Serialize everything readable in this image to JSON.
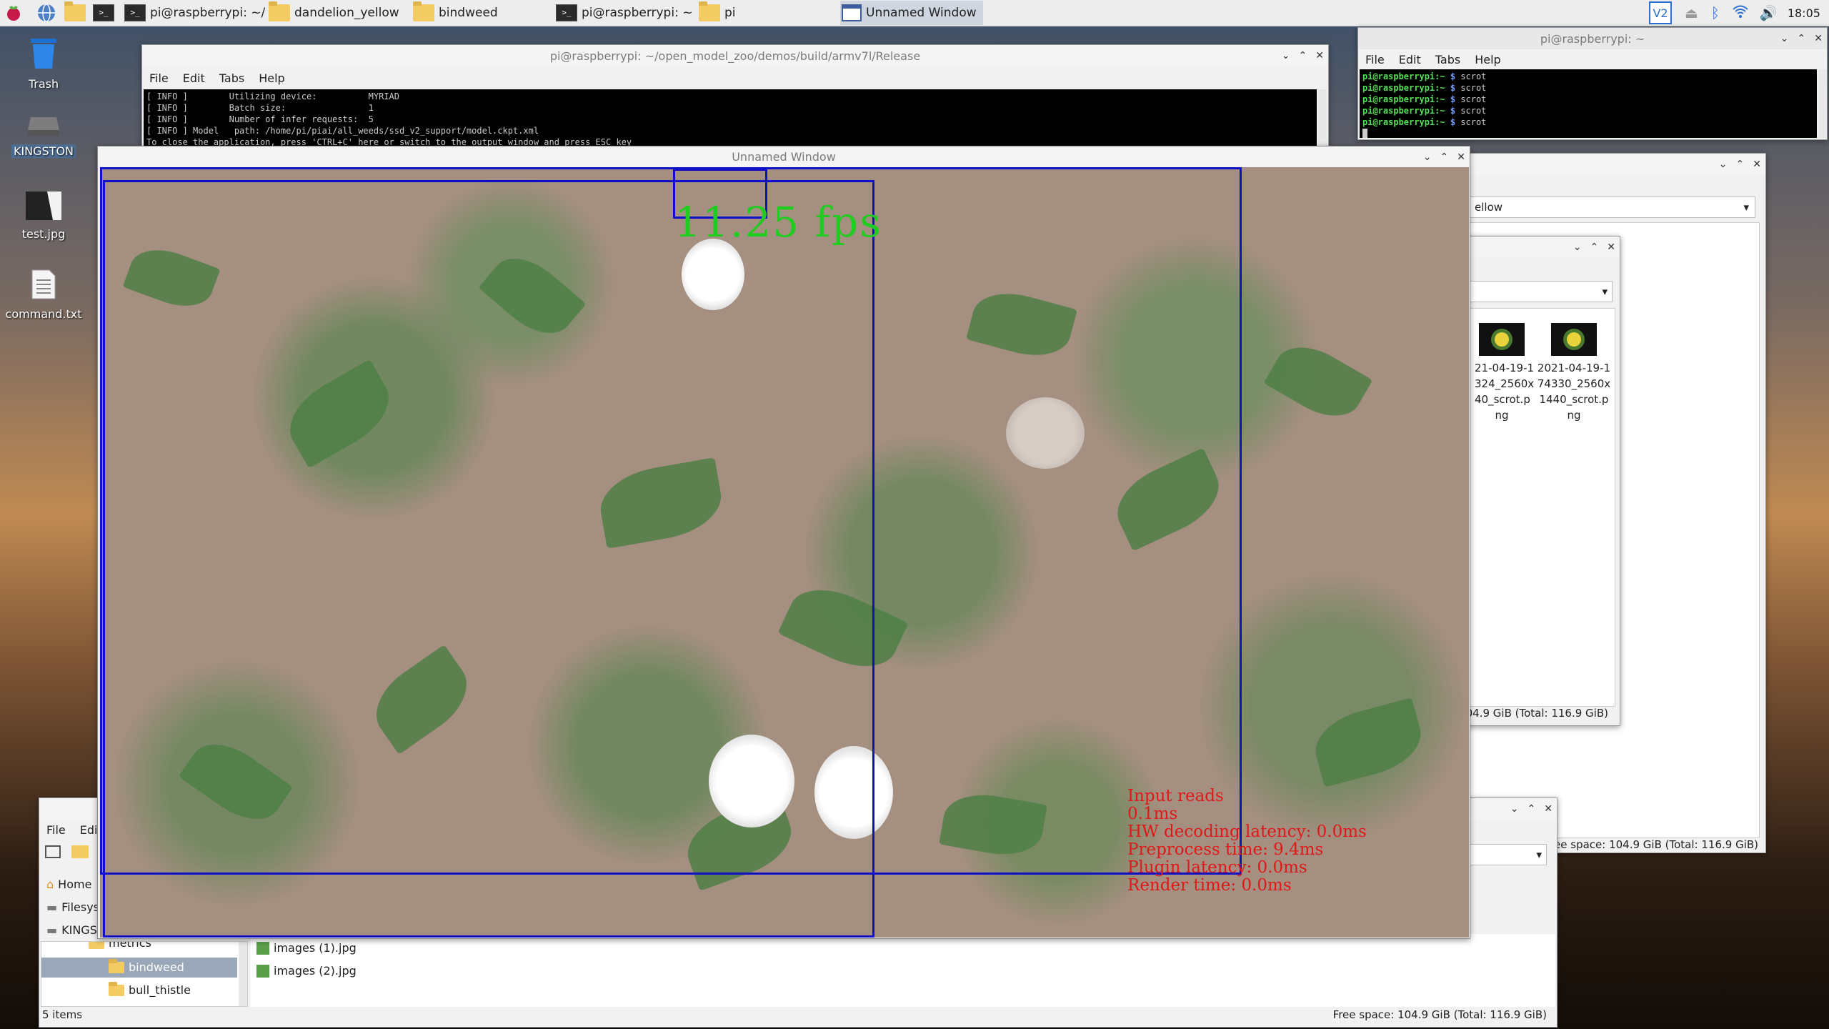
{
  "taskbar": {
    "buttons": [
      {
        "label": "pi@raspberrypi: ~/op...",
        "icon": "terminal-icon"
      },
      {
        "label": "dandelion_yellow",
        "icon": "folder-icon"
      },
      {
        "label": "bindweed",
        "icon": "folder-icon"
      },
      {
        "label": "pi@raspberrypi: ~",
        "icon": "terminal-icon"
      },
      {
        "label": "pi",
        "icon": "folder-icon"
      },
      {
        "label": "Unnamed Window",
        "icon": "window-icon"
      }
    ],
    "clock": "18:05",
    "vnc_label": "V2"
  },
  "desktop": {
    "icons": [
      {
        "label": "Trash"
      },
      {
        "label": "KINGSTON"
      },
      {
        "label": "test.jpg"
      },
      {
        "label": "command.txt"
      }
    ]
  },
  "term_main": {
    "title": "pi@raspberrypi: ~/open_model_zoo/demos/build/armv7l/Release",
    "menu": [
      "File",
      "Edit",
      "Tabs",
      "Help"
    ],
    "lines": [
      "[ INFO ]        Utilizing device:          MYRIAD",
      "[ INFO ]        Batch size:                1",
      "[ INFO ]        Number of infer requests:  5",
      "[ INFO ] Model   path: /home/pi/piai/all_weeds/ssd_v2_support/model.ckpt.xml",
      "To close the application, press 'CTRL+C' here or switch to the output window and press ESC key"
    ]
  },
  "term_small": {
    "title": "pi@raspberrypi: ~",
    "menu": [
      "File",
      "Edit",
      "Tabs",
      "Help"
    ],
    "prompt": "pi@raspberrypi:~",
    "dollar": "$",
    "command": "scrot",
    "line_count": 5
  },
  "video_window": {
    "title": "Unnamed Window",
    "fps_text": "11.25 fps",
    "stats": [
      "Input reads",
      "0.1ms",
      "HW decoding latency: 0.0ms",
      "Preprocess time: 9.4ms",
      "Plugin latency: 0.0ms",
      "Render time: 0.0ms"
    ]
  },
  "fm_dandelion": {
    "path_partial": "ellow",
    "free_space": "Free space: 104.9 GiB (Total: 116.9 GiB)"
  },
  "fm_pi": {
    "files": [
      {
        "label": "21-04-19-1\n324_2560x\n40_scrot.p\nng"
      },
      {
        "label": "2021-04-19-1\n74330_2560x\n1440_scrot.p\nng"
      }
    ],
    "free_space_partial": "04.9 GiB (Total: 116.9 GiB)"
  },
  "fm_bindweed": {
    "menu": [
      "File",
      "Edit"
    ],
    "places": [
      "Home",
      "Filesys",
      "KINGS"
    ],
    "tree": [
      "metrics",
      "bindweed",
      "bull_thistle"
    ],
    "files": [
      "images (1).jpg",
      "images (2).jpg"
    ],
    "item_count": "5 items",
    "free_space": "Free space: 104.9 GiB (Total: 116.9 GiB)"
  },
  "fm_extra": {
    "free_space": "ree space: 104.9 GiB (Total: 116.9 GiB)"
  }
}
